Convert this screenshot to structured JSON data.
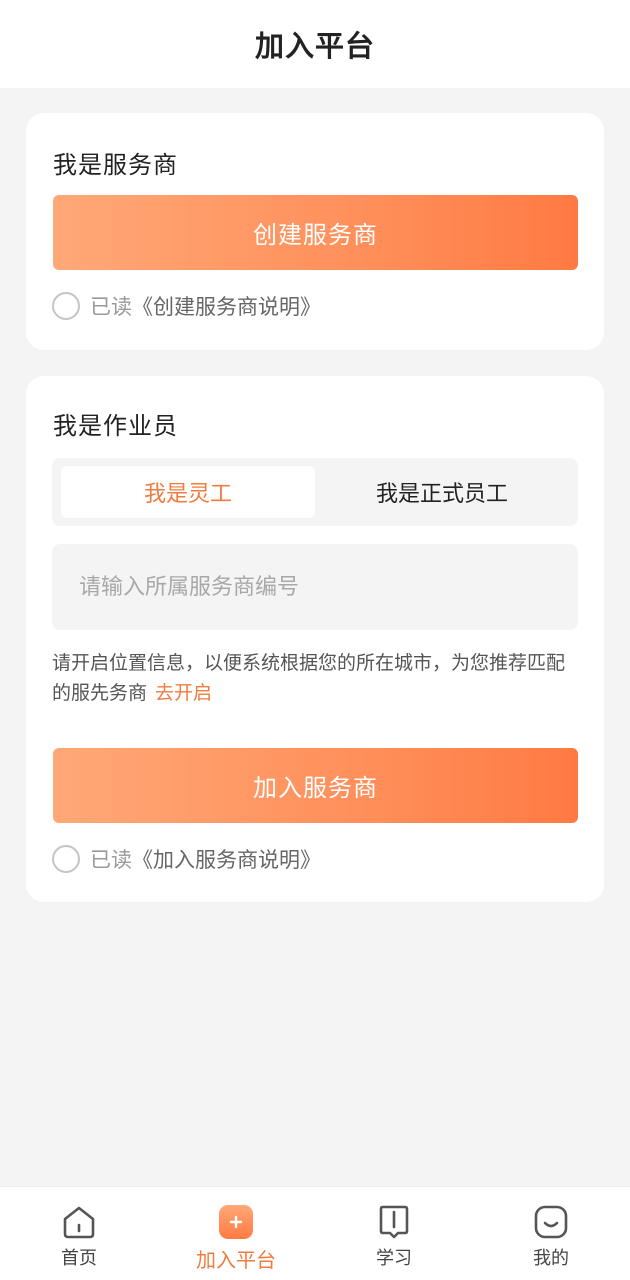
{
  "header": {
    "title": "加入平台"
  },
  "provider_section": {
    "title": "我是服务商",
    "button_label": "创建服务商",
    "agree_prefix": "已读",
    "agree_doc": "《创建服务商说明》"
  },
  "worker_section": {
    "title": "我是作业员",
    "tabs": [
      {
        "label": "我是灵工",
        "active": true
      },
      {
        "label": "我是正式员工",
        "active": false
      }
    ],
    "input_placeholder": "请输入所属服务商编号",
    "input_value": "",
    "hint_text": "请开启位置信息，以便系统根据您的所在城市，为您推荐匹配的服先务商",
    "hint_link": "去开启",
    "button_label": "加入服务商",
    "agree_prefix": "已读",
    "agree_doc": "《加入服务商说明》"
  },
  "tabbar": {
    "items": [
      {
        "label": "首页",
        "icon": "home-icon",
        "active": false
      },
      {
        "label": "加入平台",
        "icon": "plus-icon",
        "active": true
      },
      {
        "label": "学习",
        "icon": "book-icon",
        "active": false
      },
      {
        "label": "我的",
        "icon": "profile-icon",
        "active": false
      }
    ]
  },
  "colors": {
    "accent": "#f07b3f",
    "button_gradient_start": "#ffa877",
    "button_gradient_end": "#ff7a42",
    "page_background": "#f4f4f4"
  }
}
